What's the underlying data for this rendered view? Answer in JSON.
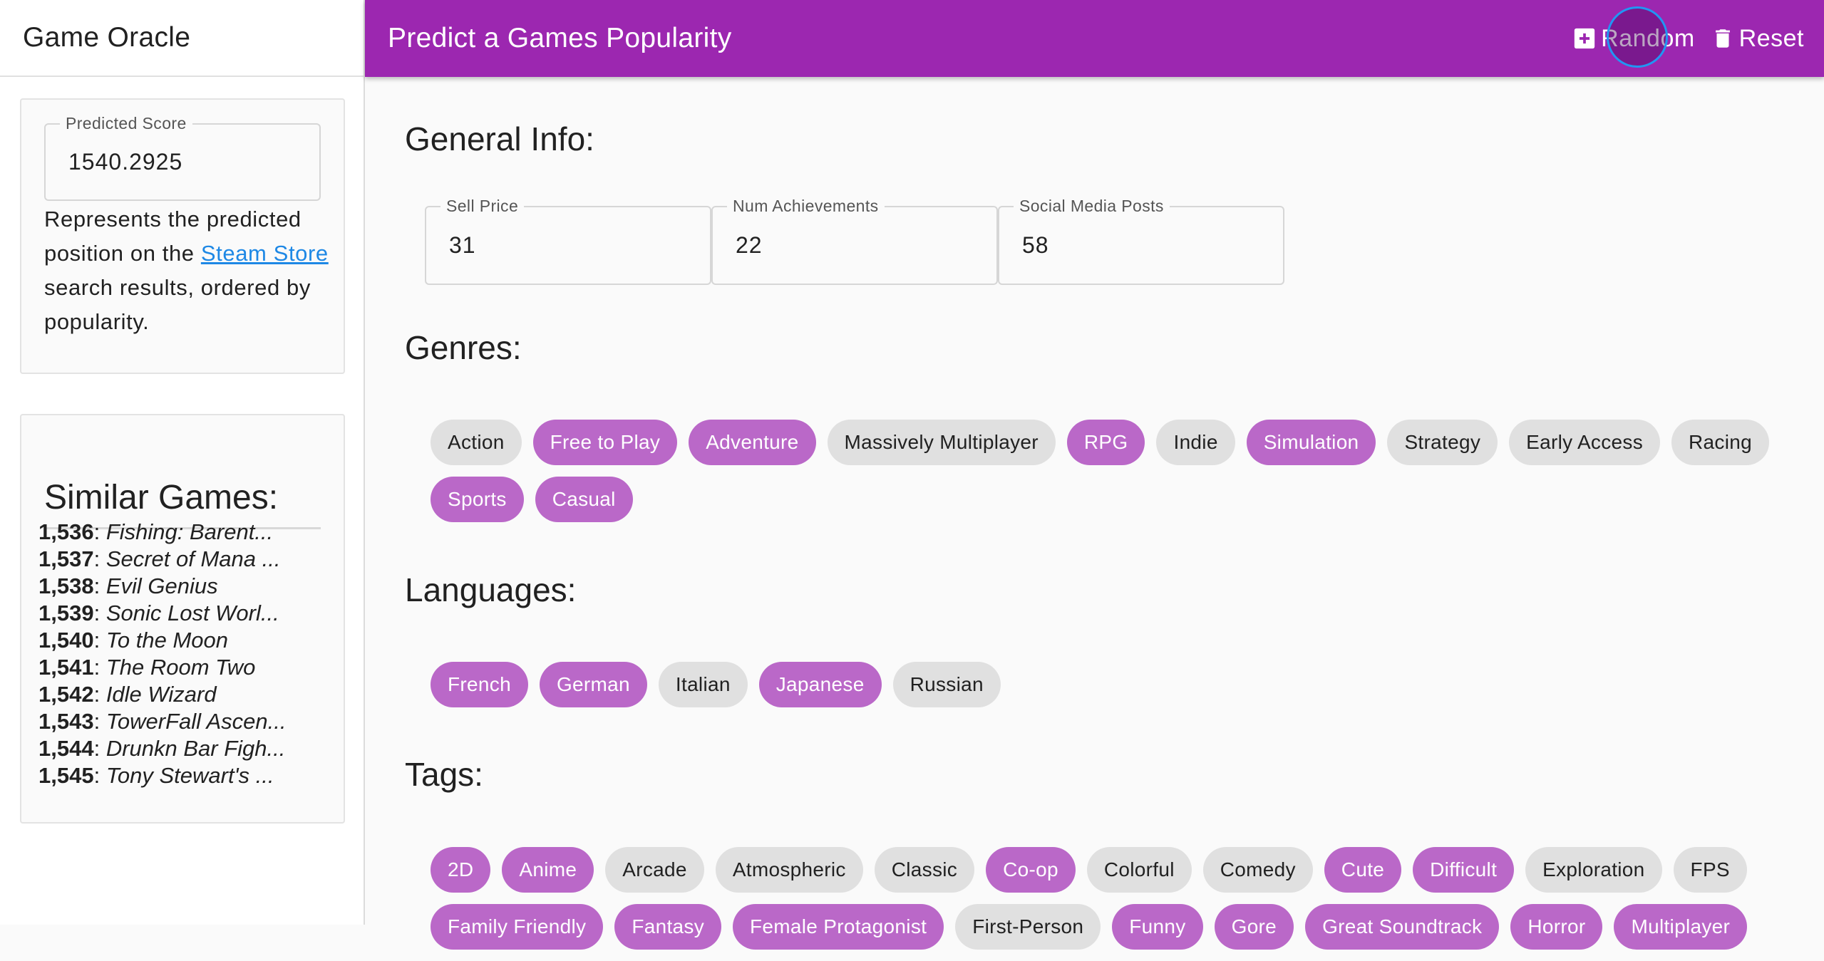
{
  "sidebar": {
    "app_title": "Game Oracle",
    "score": {
      "label": "Predicted Score",
      "value": "1540.2925",
      "desc_pre": "Represents the predicted position on the ",
      "link_text": "Steam Store",
      "desc_post": " search results, ordered by popularity."
    },
    "similar": {
      "title": "Similar Games:",
      "items": [
        {
          "rank": "1,536",
          "name": "Fishing: Barent..."
        },
        {
          "rank": "1,537",
          "name": "Secret of Mana ..."
        },
        {
          "rank": "1,538",
          "name": "Evil Genius"
        },
        {
          "rank": "1,539",
          "name": "Sonic Lost Worl..."
        },
        {
          "rank": "1,540",
          "name": "To the Moon"
        },
        {
          "rank": "1,541",
          "name": "The Room Two"
        },
        {
          "rank": "1,542",
          "name": "Idle Wizard"
        },
        {
          "rank": "1,543",
          "name": "TowerFall Ascen..."
        },
        {
          "rank": "1,544",
          "name": "Drunkn Bar Figh..."
        },
        {
          "rank": "1,545",
          "name": "Tony Stewart's ..."
        }
      ]
    }
  },
  "appbar": {
    "title": "Predict a Games Popularity",
    "random_label": "Random",
    "reset_label": "Reset"
  },
  "colors": {
    "primary": "#9c27b0",
    "chip_selected": "#ba68c8",
    "chip_default": "#e0e0e0",
    "link": "#1e88e5",
    "focus_ring": "#2196f3"
  },
  "general": {
    "title": "General Info:",
    "fields": [
      {
        "label": "Sell Price",
        "value": "31"
      },
      {
        "label": "Num Achievements",
        "value": "22"
      },
      {
        "label": "Social Media Posts",
        "value": "58"
      }
    ]
  },
  "genres": {
    "title": "Genres:",
    "items": [
      {
        "label": "Action",
        "selected": false
      },
      {
        "label": "Free to Play",
        "selected": true
      },
      {
        "label": "Adventure",
        "selected": true
      },
      {
        "label": "Massively Multiplayer",
        "selected": false
      },
      {
        "label": "RPG",
        "selected": true
      },
      {
        "label": "Indie",
        "selected": false
      },
      {
        "label": "Simulation",
        "selected": true
      },
      {
        "label": "Strategy",
        "selected": false
      },
      {
        "label": "Early Access",
        "selected": false
      },
      {
        "label": "Racing",
        "selected": false
      },
      {
        "label": "Sports",
        "selected": true
      },
      {
        "label": "Casual",
        "selected": true
      }
    ]
  },
  "languages": {
    "title": "Languages:",
    "items": [
      {
        "label": "French",
        "selected": true
      },
      {
        "label": "German",
        "selected": true
      },
      {
        "label": "Italian",
        "selected": false
      },
      {
        "label": "Japanese",
        "selected": true
      },
      {
        "label": "Russian",
        "selected": false
      }
    ]
  },
  "tags": {
    "title": "Tags:",
    "items": [
      {
        "label": "2D",
        "selected": true
      },
      {
        "label": "Anime",
        "selected": true
      },
      {
        "label": "Arcade",
        "selected": false
      },
      {
        "label": "Atmospheric",
        "selected": false
      },
      {
        "label": "Classic",
        "selected": false
      },
      {
        "label": "Co-op",
        "selected": true
      },
      {
        "label": "Colorful",
        "selected": false
      },
      {
        "label": "Comedy",
        "selected": false
      },
      {
        "label": "Cute",
        "selected": true
      },
      {
        "label": "Difficult",
        "selected": true
      },
      {
        "label": "Exploration",
        "selected": false
      },
      {
        "label": "FPS",
        "selected": false
      },
      {
        "label": "Family Friendly",
        "selected": true
      },
      {
        "label": "Fantasy",
        "selected": true
      },
      {
        "label": "Female Protagonist",
        "selected": true
      },
      {
        "label": "First-Person",
        "selected": false
      },
      {
        "label": "Funny",
        "selected": true
      },
      {
        "label": "Gore",
        "selected": true
      },
      {
        "label": "Great Soundtrack",
        "selected": true
      },
      {
        "label": "Horror",
        "selected": true
      },
      {
        "label": "Multiplayer",
        "selected": true
      }
    ]
  }
}
